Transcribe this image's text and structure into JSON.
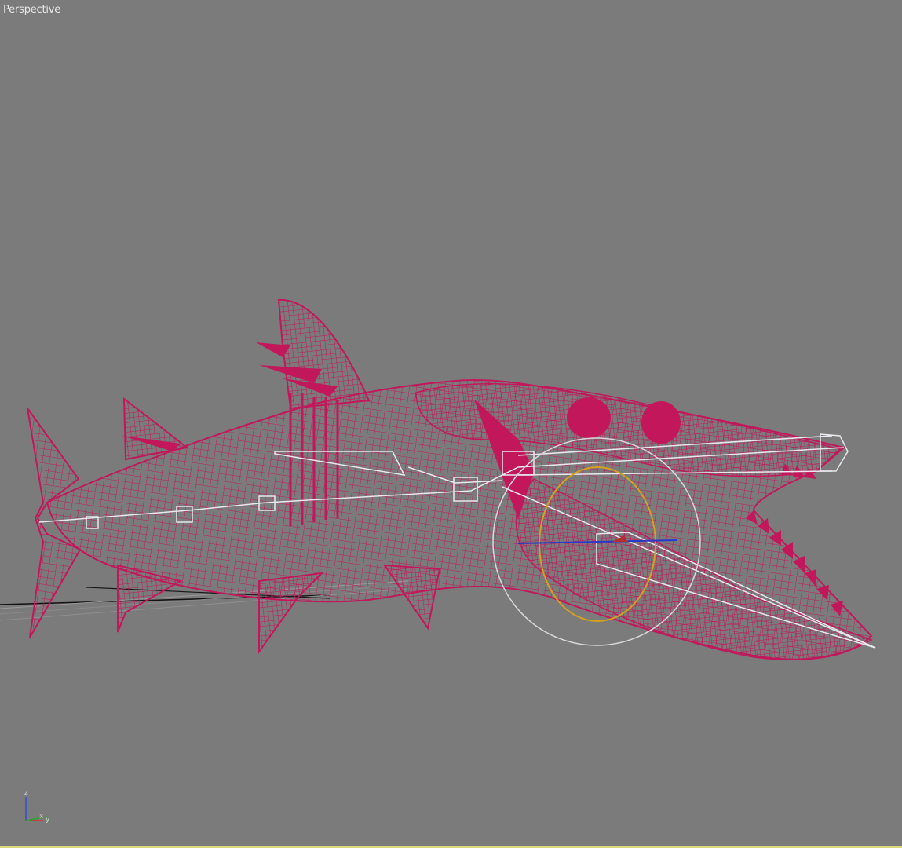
{
  "viewport": {
    "label": "Perspective",
    "background": "#7b7b7b"
  },
  "model": {
    "name": "barracuda-fish-mesh",
    "wire_color": "#c2185b",
    "bone_color": "#e8e8ee",
    "controller_color": "#d4a020"
  },
  "axis_gizmo": {
    "z_label": "z",
    "x_label": "x",
    "y_label": "y",
    "z_color": "#3050d0",
    "x_color": "#d03030",
    "y_color": "#30a030"
  }
}
